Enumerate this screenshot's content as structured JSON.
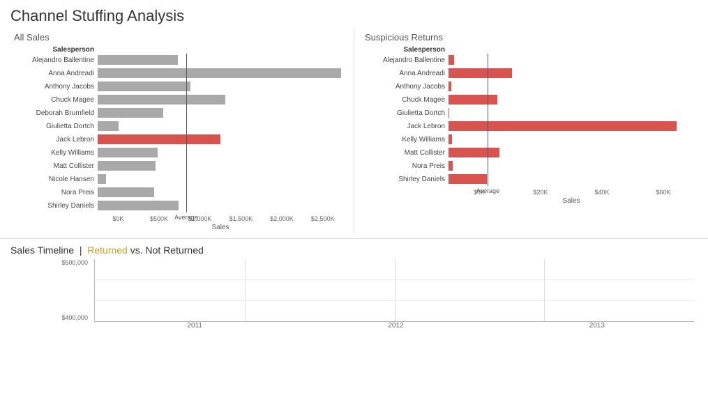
{
  "title": "Channel Stuffing Analysis",
  "allSales": {
    "subtitle": "All Sales",
    "colHeader": "Salesperson",
    "axisLabel": "Sales",
    "avgLabel": "Average",
    "maxValue": 2700000,
    "tickLabels": [
      "$0K",
      "$500K",
      "$1,000K",
      "$1,500K",
      "$2,000K",
      "$2,500K"
    ],
    "rows": [
      {
        "name": "Alejandro Ballentine",
        "value": 880000,
        "color": "gray"
      },
      {
        "name": "Anna Andreadi",
        "value": 2680000,
        "color": "gray"
      },
      {
        "name": "Anthony Jacobs",
        "value": 1020000,
        "color": "gray"
      },
      {
        "name": "Chuck Magee",
        "value": 1400000,
        "color": "gray"
      },
      {
        "name": "Deborah Brumfield",
        "value": 720000,
        "color": "gray"
      },
      {
        "name": "Giulietta Dortch",
        "value": 230000,
        "color": "gray"
      },
      {
        "name": "Jack Lebron",
        "value": 1350000,
        "color": "red"
      },
      {
        "name": "Kelly Williams",
        "value": 660000,
        "color": "gray"
      },
      {
        "name": "Matt Collister",
        "value": 640000,
        "color": "gray"
      },
      {
        "name": "Nicole Hansen",
        "value": 90000,
        "color": "gray"
      },
      {
        "name": "Nora Preis",
        "value": 620000,
        "color": "gray"
      },
      {
        "name": "Shirley Daniels",
        "value": 890000,
        "color": "gray"
      }
    ],
    "avgLinePercent": 36
  },
  "suspiciousReturns": {
    "subtitle": "Suspicious Returns",
    "colHeader": "Salesperson",
    "axisLabel": "Sales",
    "avgLabel": "Average",
    "maxValue": 70000,
    "tickLabels": [
      "$0K",
      "$20K",
      "$40K",
      "$60K"
    ],
    "rows": [
      {
        "name": "Alejandro Ballentine",
        "value": 1500,
        "color": "red"
      },
      {
        "name": "Anna Andreadi",
        "value": 18000,
        "color": "red"
      },
      {
        "name": "Anthony Jacobs",
        "value": 800,
        "color": "red"
      },
      {
        "name": "Chuck Magee",
        "value": 14000,
        "color": "red"
      },
      {
        "name": "Giulietta Dortch",
        "value": 200,
        "color": "red"
      },
      {
        "name": "Jack Lebron",
        "value": 65000,
        "color": "red"
      },
      {
        "name": "Kelly Williams",
        "value": 900,
        "color": "red"
      },
      {
        "name": "Matt Collister",
        "value": 14500,
        "color": "red"
      },
      {
        "name": "Nora Preis",
        "value": 1200,
        "color": "red"
      },
      {
        "name": "Shirley Daniels",
        "value": 11000,
        "color": "red"
      }
    ],
    "avgLinePercent": 16
  },
  "timeline": {
    "title": "Sales Timeline",
    "returnedLabel": "Returned",
    "vsLabel": "vs. Not Returned",
    "xLabels": [
      "2011",
      "2012",
      "2013"
    ],
    "yLabels": [
      "$500,000",
      "$400,000"
    ]
  }
}
